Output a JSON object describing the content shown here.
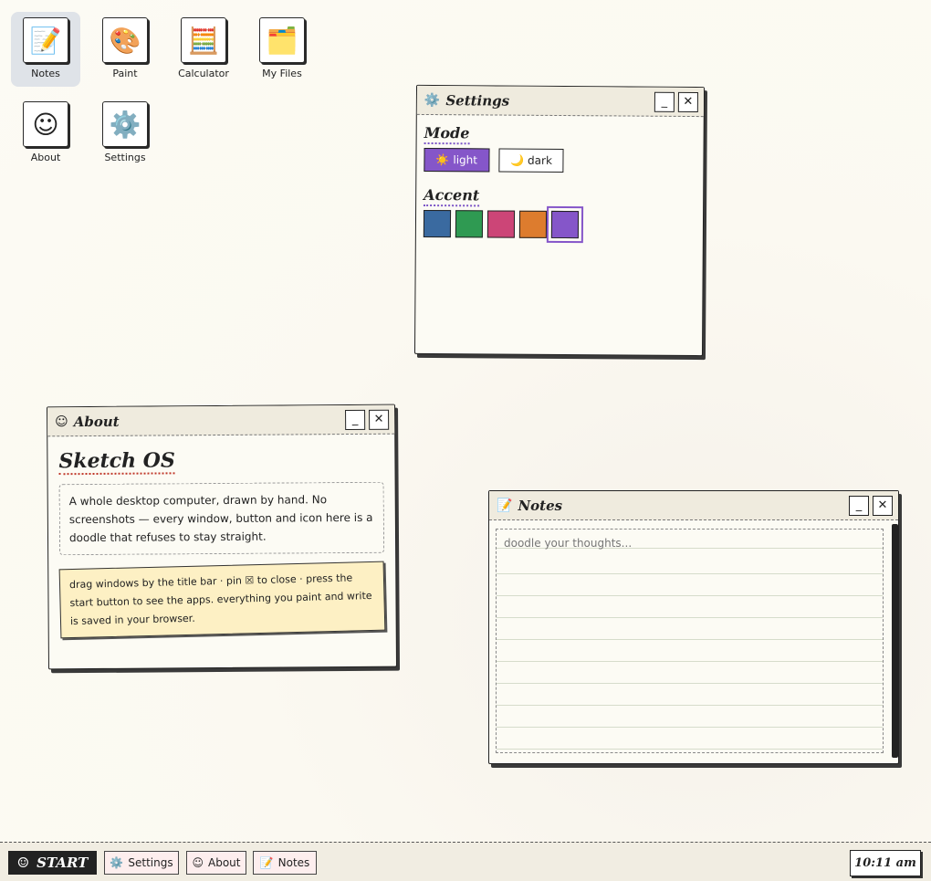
{
  "desktop": {
    "icons": [
      {
        "label": "Notes",
        "glyph": "📝"
      },
      {
        "label": "Paint",
        "glyph": "🎨"
      },
      {
        "label": "Calculator",
        "glyph": "🧮"
      },
      {
        "label": "My Files",
        "glyph": "🗂️"
      },
      {
        "label": "About",
        "glyph": "☺"
      },
      {
        "label": "Settings",
        "glyph": "⚙️"
      }
    ]
  },
  "settings_window": {
    "icon": "⚙️",
    "title": "Settings",
    "minimize": "_",
    "close": "✕",
    "mode_heading": "Mode",
    "light": {
      "icon": "☀️",
      "label": "light"
    },
    "dark": {
      "icon": "🌙",
      "label": "dark"
    },
    "accent_heading": "Accent",
    "accent_colors": [
      "#3a6aa0",
      "#2f9a52",
      "#cc4577",
      "#dd7c2e",
      "#8556c9"
    ],
    "selected_accent": "#8556c9"
  },
  "about_window": {
    "icon": "☺",
    "title": "About",
    "minimize": "_",
    "close": "✕",
    "heading": "Sketch OS",
    "description": "A whole desktop computer, drawn by hand. No screenshots — every window, button and icon here is a doodle that refuses to stay straight.",
    "tip": "drag windows by the title bar · pin ☒ to close · press the start button to see the apps. everything you paint and write is saved in your browser."
  },
  "notes_window": {
    "icon": "📝",
    "title": "Notes",
    "minimize": "_",
    "close": "✕",
    "placeholder": "doodle your thoughts..."
  },
  "taskbar": {
    "start_icon": "☺",
    "start_label": "START",
    "tasks": [
      {
        "icon": "⚙️",
        "label": "Settings"
      },
      {
        "icon": "☺",
        "label": "About"
      },
      {
        "icon": "📝",
        "label": "Notes"
      }
    ],
    "clock": "10:11 am"
  }
}
